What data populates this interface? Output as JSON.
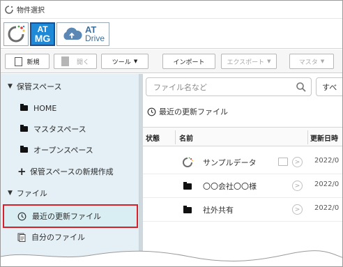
{
  "window": {
    "title": "物件選択"
  },
  "products": {
    "at_mg": {
      "line1": "AT",
      "line2": "MG"
    },
    "at_drive": {
      "line1": "AT",
      "line2": "Drive"
    }
  },
  "toolbar": {
    "new_label": "新規",
    "open_label": "開く",
    "tool_label": "ツール",
    "import_label": "インポート",
    "export_label": "エクスポート",
    "master_label": "マスタ"
  },
  "sidebar": {
    "storage_header": "保管スペース",
    "items": [
      {
        "label": "HOME"
      },
      {
        "label": "マスタスペース"
      },
      {
        "label": "オープンスペース"
      }
    ],
    "new_storage": "保管スペースの新規作成",
    "files_header": "ファイル",
    "recent_files": "最近の更新ファイル",
    "my_files": "自分のファイル"
  },
  "main": {
    "search_placeholder": "ファイル名など",
    "filter_label": "すべ",
    "section_title": "最近の更新ファイル",
    "columns": {
      "status": "状態",
      "name": "名前",
      "updated": "更新日時"
    },
    "rows": [
      {
        "name": "サンプルデータ",
        "date": "2022/0"
      },
      {
        "name": "〇〇会社〇〇様",
        "date": "2022/0"
      },
      {
        "name": "社外共有",
        "date": "2022/0"
      }
    ]
  },
  "colors": {
    "selection_border": "#d7202a",
    "sidebar_bg": "#e5f0f6",
    "brand_blue": "#1e89d6"
  }
}
